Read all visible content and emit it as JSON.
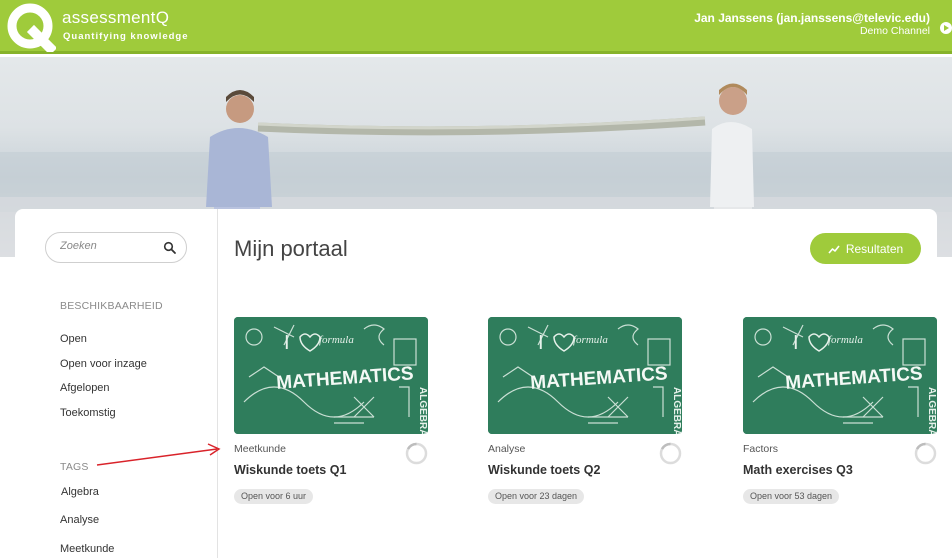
{
  "header": {
    "logo_letter": "Q",
    "brand": "assessmentQ",
    "tagline": "Quantifying knowledge",
    "user": "Jan Janssens (jan.janssens@televic.edu)",
    "channel": "Demo Channel"
  },
  "sidebar": {
    "search_placeholder": "Zoeken",
    "availability_label": "BESCHIKBAARHEID",
    "availability_items": [
      "Open",
      "Open voor inzage",
      "Afgelopen",
      "Toekomstig"
    ],
    "tags_label": "TAGS",
    "tag_items": [
      "Algebra",
      "Analyse",
      "Meetkunde"
    ]
  },
  "main": {
    "title": "Mijn portaal",
    "results_button": "Resultaten",
    "tests": [
      {
        "tag": "Meetkunde",
        "title": "Wiskunde toets Q1",
        "status": "Open voor 6 uur"
      },
      {
        "tag": "Analyse",
        "title": "Wiskunde toets Q2",
        "status": "Open voor 23 dagen"
      },
      {
        "tag": "Factors",
        "title": "Math exercises Q3",
        "status": "Open voor 53 dagen"
      }
    ],
    "thumb_text": {
      "word": "MATHEMATICS",
      "love": "I",
      "formula": "formula",
      "algebra": "ALGEBRA"
    }
  },
  "colors": {
    "brand_green": "#9fcb3b",
    "chalkboard": "#2d7a5a",
    "annotation": "#d9232a"
  }
}
